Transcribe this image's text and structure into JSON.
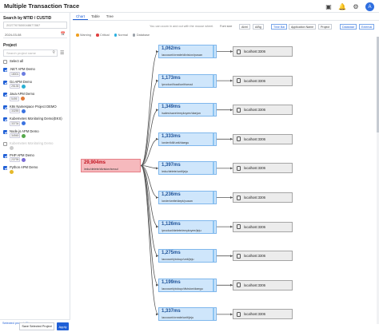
{
  "window": {
    "title": "Multiple Transaction Trace"
  },
  "topbar": {
    "avatar_initial": "A"
  },
  "search": {
    "label": "Search by MTID / CUSTID",
    "mtid_value": "2027767600048677867",
    "date_value": "2024-03-08"
  },
  "projects": {
    "label": "Project",
    "search_placeholder": "Search project name",
    "select_all_label": "Select all",
    "items": [
      {
        "name": ".NET APM Demo",
        "id": "18001",
        "checked": true,
        "type_color": "#6b7de0"
      },
      {
        "name": "Go APM Demo",
        "id": "25135",
        "checked": true,
        "type_color": "#2bb0d3"
      },
      {
        "name": "Java APM Demo",
        "id": "5495",
        "checked": true,
        "type_color": "#e07a3a"
      },
      {
        "name": "K8s Namespace Project DEMO",
        "id": "33255",
        "checked": true,
        "type_color": "#3b73e0"
      },
      {
        "name": "Kubernetes Monitoring Demo(EKS)",
        "id": "33734",
        "checked": true,
        "type_color": "#3b73e0"
      },
      {
        "name": "Node.js APM Demo",
        "id": "34945",
        "checked": true,
        "type_color": "#55a84a"
      },
      {
        "name": "Kubernetes Monitoring Demo",
        "id": "",
        "checked": false,
        "type_color": "#cccccc"
      },
      {
        "name": "PHP APM Demo",
        "id": "23795",
        "checked": true,
        "type_color": "#7a6bd6"
      },
      {
        "name": "Python APM Demo",
        "id": "",
        "checked": true,
        "type_color": "#e5b92a"
      }
    ]
  },
  "footer": {
    "selected_count": "Selected project (8)",
    "save_label": "Save Selected Project",
    "apply_label": "Apply"
  },
  "tabs": [
    "Chart",
    "Table",
    "Tree"
  ],
  "toolbar": {
    "hint": "You can zoom in and out with the mouse wheel.",
    "font_label": "Font size",
    "font_small": "Al/ml",
    "font_large": "A/Bg",
    "buttons": [
      "Time Bar",
      "Application Name",
      "Project",
      "Database",
      "External"
    ]
  },
  "legend": [
    {
      "label": "Warning",
      "color": "#f0a020"
    },
    {
      "label": "Critical",
      "color": "#e04040"
    },
    {
      "label": "Normal",
      "color": "#2bb0e0"
    },
    {
      "label": "Database",
      "color": "#9aa0a8"
    }
  ],
  "colors": {
    "accent": "#1f5fd6",
    "critical": "#e04040",
    "service": "#cfe6fb",
    "db": "#ececec"
  },
  "trace": {
    "root": {
      "ms": "29,904ms",
      "path": "/edu/delete/division/seoul"
    },
    "services": [
      {
        "ms": "1,062ms",
        "path": "/account/create/division/pusan",
        "db": "localhost:3306"
      },
      {
        "ms": "1,173ms",
        "path": "/product/load/unit/seoul",
        "db": "localhost:3306"
      },
      {
        "ms": "1,349ms",
        "path": "/sales/save/employee/daejun",
        "db": "localhost:3306"
      },
      {
        "ms": "1,333ms",
        "path": "/order/kill/unit/daegu",
        "db": "localhost:3306"
      },
      {
        "ms": "1,397ms",
        "path": "/edu/delete/unit/jeju",
        "db": "localhost:3306"
      },
      {
        "ms": "1,236ms",
        "path": "/order/write/dept/pusan",
        "db": "localhost:3306"
      },
      {
        "ms": "1,126ms",
        "path": "/product/delete/employee/jeju",
        "db": "localhost:3306"
      },
      {
        "ms": "1,275ms",
        "path": "/account/pickup/unit/jeju",
        "db": "localhost:3306"
      },
      {
        "ms": "1,199ms",
        "path": "/account/pickup/division/daegu",
        "db": "localhost:3306"
      },
      {
        "ms": "1,337ms",
        "path": "/account/create/unit/jeju",
        "db": "localhost:3306"
      }
    ]
  }
}
